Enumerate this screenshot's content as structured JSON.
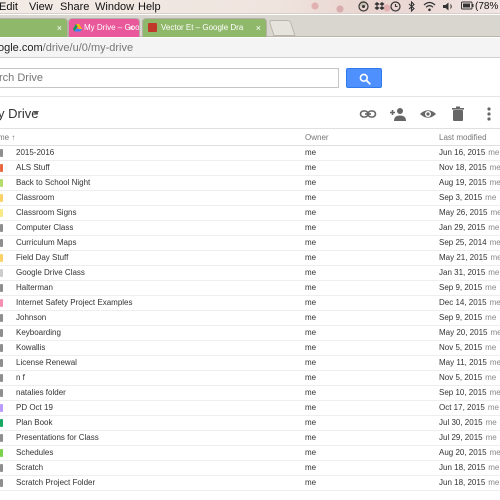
{
  "menubar": {
    "items": [
      "Edit",
      "View",
      "Share",
      "Window",
      "Help"
    ],
    "battery": "(78%"
  },
  "tabs": {
    "active_label": "My Drive – Google Drive",
    "other_label": "Vector Et – Google Dra",
    "close_glyph": "×"
  },
  "address": {
    "host": "ogle.com",
    "path": "/drive/u/0/my-drive"
  },
  "search": {
    "placeholder": "rch Drive"
  },
  "toolbar": {
    "title": "y Drive"
  },
  "columns": {
    "name": "me ↑",
    "owner": "Owner",
    "modified": "Last modified"
  },
  "icons": [
    "link-icon",
    "add-person-icon",
    "preview-eye-icon",
    "trash-icon",
    "more-vert-icon",
    "search-icon"
  ],
  "colors": {
    "search_button": "#4d90fe",
    "active_tab": "#e8589a",
    "inactive_tab": "#8fb86a"
  },
  "rows": [
    {
      "name": "2015-2016",
      "owner": "me",
      "modified": "Jun 16, 2015",
      "by": "me",
      "color": "#8e8e8e"
    },
    {
      "name": "ALS Stuff",
      "owner": "me",
      "modified": "Nov 18, 2015",
      "by": "me",
      "color": "#e8693f"
    },
    {
      "name": "Back to School Night",
      "owner": "me",
      "modified": "Aug 19, 2015",
      "by": "me",
      "color": "#b3dc6c"
    },
    {
      "name": "Classroom",
      "owner": "me",
      "modified": "Sep 3, 2015",
      "by": "me",
      "color": "#fad165"
    },
    {
      "name": "Classroom Signs",
      "owner": "me",
      "modified": "May 26, 2015",
      "by": "me",
      "color": "#fbe983"
    },
    {
      "name": "Computer Class",
      "owner": "me",
      "modified": "Jan 29, 2015",
      "by": "me",
      "color": "#8e8e8e"
    },
    {
      "name": "Curriculum Maps",
      "owner": "me",
      "modified": "Sep 25, 2014",
      "by": "me",
      "color": "#8e8e8e"
    },
    {
      "name": "Field Day Stuff",
      "owner": "me",
      "modified": "May 21, 2015",
      "by": "me",
      "color": "#fad165"
    },
    {
      "name": "Google Drive Class",
      "owner": "me",
      "modified": "Jan 31, 2015",
      "by": "me",
      "color": "#cccccc"
    },
    {
      "name": "Halterman",
      "owner": "me",
      "modified": "Sep 9, 2015",
      "by": "me",
      "color": "#8e8e8e"
    },
    {
      "name": "Internet Safety Project Examples",
      "owner": "me",
      "modified": "Dec 14, 2015",
      "by": "me",
      "color": "#f691b2"
    },
    {
      "name": "Johnson",
      "owner": "me",
      "modified": "Sep 9, 2015",
      "by": "me",
      "color": "#8e8e8e"
    },
    {
      "name": "Keyboarding",
      "owner": "me",
      "modified": "May 20, 2015",
      "by": "me",
      "color": "#8e8e8e"
    },
    {
      "name": "Kowallis",
      "owner": "me",
      "modified": "Nov 5, 2015",
      "by": "me",
      "color": "#8e8e8e"
    },
    {
      "name": "License Renewal",
      "owner": "me",
      "modified": "May 11, 2015",
      "by": "me",
      "color": "#8e8e8e"
    },
    {
      "name": "n f",
      "owner": "me",
      "modified": "Nov 5, 2015",
      "by": "me",
      "color": "#8e8e8e"
    },
    {
      "name": "natalies folder",
      "owner": "me",
      "modified": "Sep 10, 2015",
      "by": "me",
      "color": "#8e8e8e"
    },
    {
      "name": "PD Oct 19",
      "owner": "me",
      "modified": "Oct 17, 2015",
      "by": "me",
      "color": "#b99aff"
    },
    {
      "name": "Plan Book",
      "owner": "me",
      "modified": "Jul 30, 2015",
      "by": "me",
      "color": "#16a765"
    },
    {
      "name": "Presentations for Class",
      "owner": "me",
      "modified": "Jul 29, 2015",
      "by": "me",
      "color": "#8e8e8e"
    },
    {
      "name": "Schedules",
      "owner": "me",
      "modified": "Aug 20, 2015",
      "by": "me",
      "color": "#7bd148"
    },
    {
      "name": "Scratch",
      "owner": "me",
      "modified": "Jun 18, 2015",
      "by": "me",
      "color": "#8e8e8e"
    },
    {
      "name": "Scratch Project Folder",
      "owner": "me",
      "modified": "Jun 18, 2015",
      "by": "me",
      "color": "#8e8e8e"
    }
  ]
}
